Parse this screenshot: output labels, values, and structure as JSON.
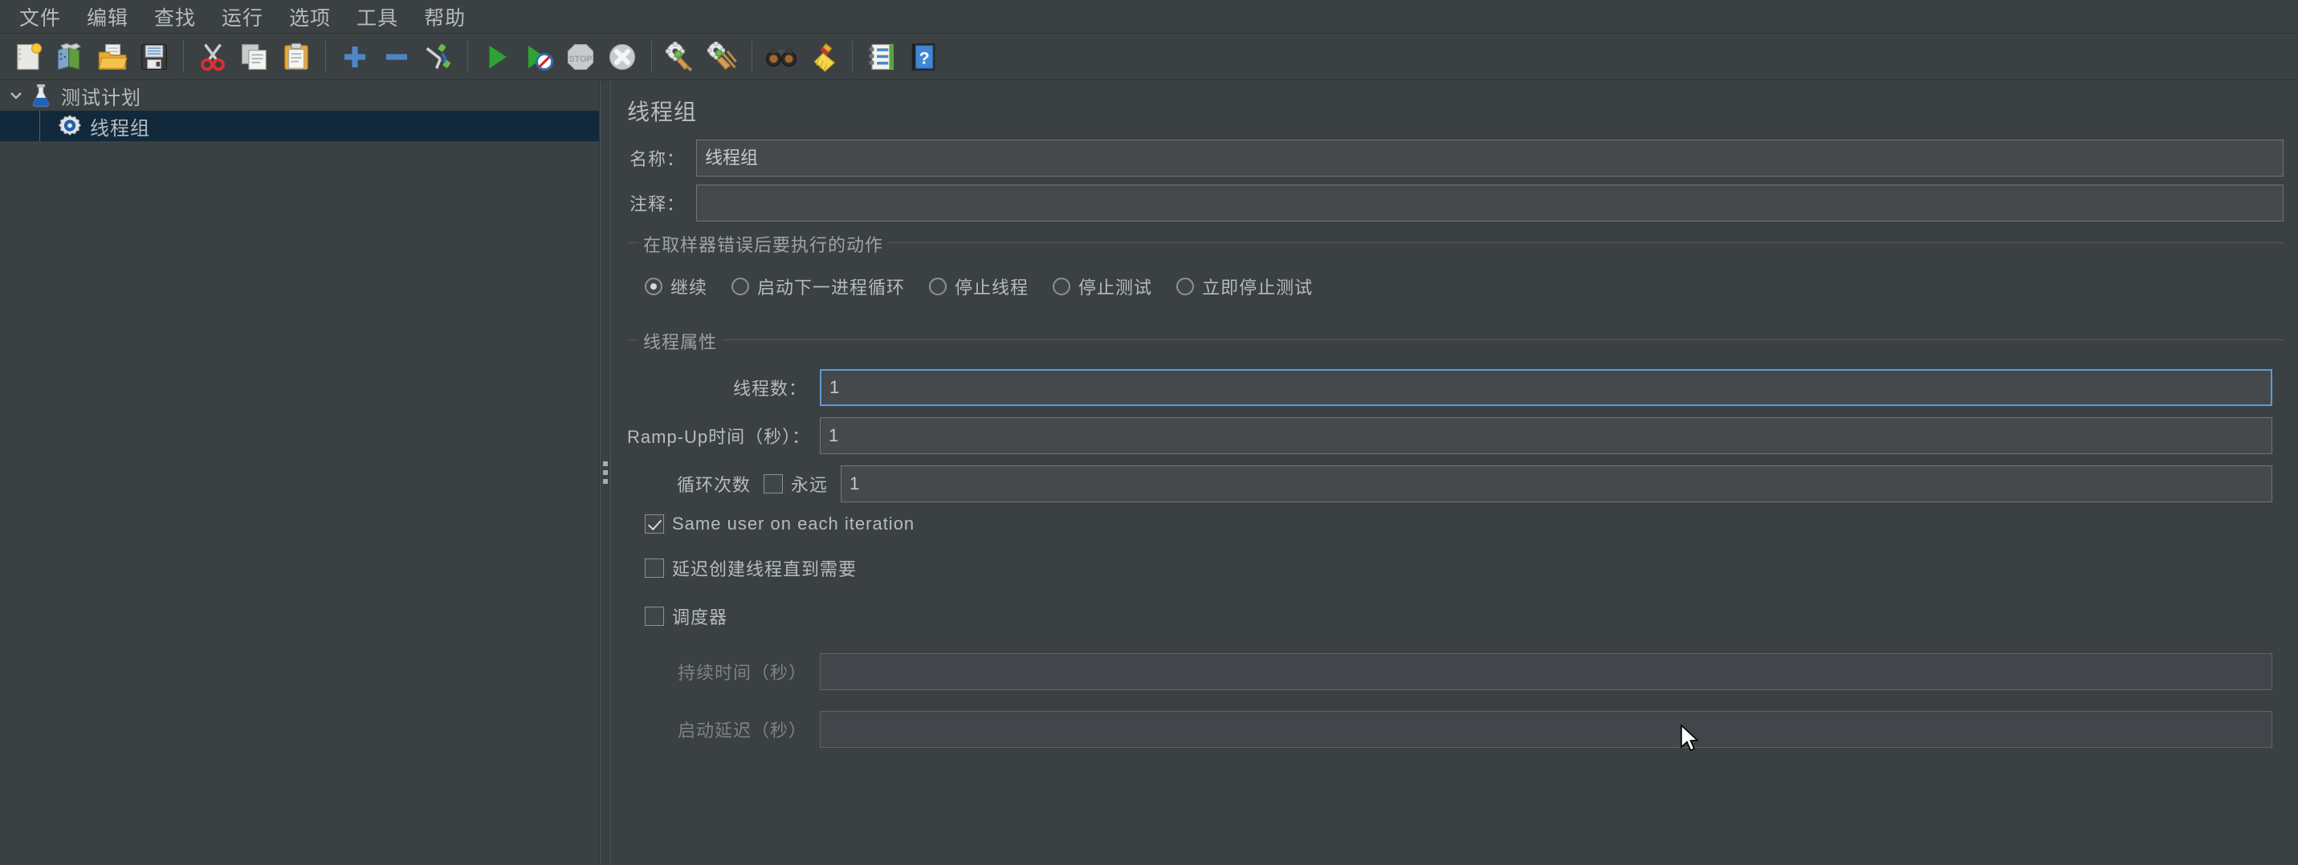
{
  "menubar": {
    "items": [
      {
        "label": "文件",
        "name": "menu-file"
      },
      {
        "label": "编辑",
        "name": "menu-edit"
      },
      {
        "label": "查找",
        "name": "menu-search"
      },
      {
        "label": "运行",
        "name": "menu-run"
      },
      {
        "label": "选项",
        "name": "menu-options"
      },
      {
        "label": "工具",
        "name": "menu-tools"
      },
      {
        "label": "帮助",
        "name": "menu-help"
      }
    ]
  },
  "toolbar": {
    "buttons": [
      {
        "icon": "new-document-icon"
      },
      {
        "icon": "open-templates-icon"
      },
      {
        "icon": "open-folder-icon"
      },
      {
        "icon": "save-floppy-icon"
      },
      {
        "icon": "separator"
      },
      {
        "icon": "cut-scissors-icon"
      },
      {
        "icon": "copy-icon"
      },
      {
        "icon": "paste-clipboard-icon"
      },
      {
        "icon": "separator"
      },
      {
        "icon": "expand-plus-icon"
      },
      {
        "icon": "collapse-minus-icon"
      },
      {
        "icon": "toggle-element-icon"
      },
      {
        "icon": "separator"
      },
      {
        "icon": "start-play-icon"
      },
      {
        "icon": "start-no-timers-icon"
      },
      {
        "icon": "stop-icon"
      },
      {
        "icon": "shutdown-icon"
      },
      {
        "icon": "separator"
      },
      {
        "icon": "clear-icon"
      },
      {
        "icon": "clear-all-icon"
      },
      {
        "icon": "separator"
      },
      {
        "icon": "search-binoculars-icon"
      },
      {
        "icon": "reset-search-broom-icon"
      },
      {
        "icon": "separator"
      },
      {
        "icon": "function-helper-icon"
      },
      {
        "icon": "help-book-icon"
      }
    ]
  },
  "tree": {
    "root": {
      "label": "测试计划",
      "icon": "test-plan-flask-icon",
      "expanded": true
    },
    "child": {
      "label": "线程组",
      "icon": "thread-group-gear-icon",
      "selected": true
    }
  },
  "panel": {
    "title": "线程组",
    "name_label": "名称：",
    "name_value": "线程组",
    "comment_label": "注释：",
    "comment_value": "",
    "error_action": {
      "group_title": "在取样器错误后要执行的动作",
      "options": [
        {
          "label": "继续",
          "checked": true
        },
        {
          "label": "启动下一进程循环",
          "checked": false
        },
        {
          "label": "停止线程",
          "checked": false
        },
        {
          "label": "停止测试",
          "checked": false
        },
        {
          "label": "立即停止测试",
          "checked": false
        }
      ]
    },
    "thread_props": {
      "group_title": "线程属性",
      "threads_label": "线程数：",
      "threads_value": "1",
      "rampup_label": "Ramp-Up时间（秒）：",
      "rampup_value": "1",
      "loops_label": "循环次数",
      "forever_label": "永远",
      "forever_checked": false,
      "loops_value": "1",
      "same_user_label": "Same user on each iteration",
      "same_user_checked": true,
      "delayed_start_label": "延迟创建线程直到需要",
      "delayed_start_checked": false,
      "scheduler_label": "调度器",
      "scheduler_checked": false,
      "duration_label": "持续时间（秒）",
      "duration_value": "",
      "startup_delay_label": "启动延迟（秒）",
      "startup_delay_value": ""
    }
  },
  "colors": {
    "background": "#3b4043",
    "selection": "#12293c",
    "focus_border": "#5b9bd5",
    "text": "#b6bbbe"
  }
}
